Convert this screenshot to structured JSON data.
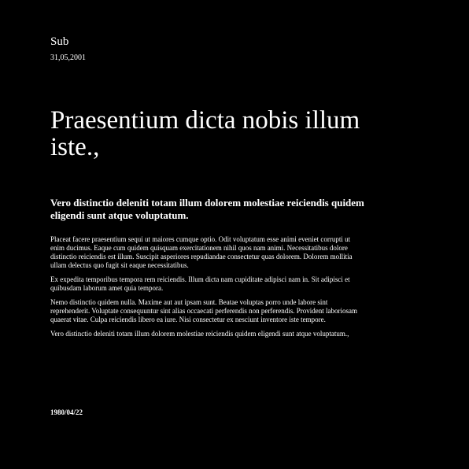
{
  "header": {
    "sub_label": "Sub",
    "date": "31,05,2001"
  },
  "article": {
    "title": "Praesentium dicta nobis illum iste.,",
    "lead": "Vero distinctio deleniti totam illum dolorem molestiae reiciendis quidem eligendi sunt atque voluptatum.",
    "paragraphs": [
      "Placeat facere praesentium sequi ut maiores cumque optio. Odit voluptatum esse animi eveniet corrupti ut enim ducimus. Eaque cum quidem quisquam exercitationem nihil quos nam animi. Necessitatibus dolore distinctio reiciendis est illum. Suscipit asperiores repudiandae consectetur quas dolorem. Dolorem mollitia ullam delectus quo fugit sit eaque necessitatibus.",
      "Ex expedita temporibus tempora rem reiciendis. Illum dicta nam cupiditate adipisci nam in. Sit adipisci et quibusdam laborum amet quia tempora.",
      "Nemo distinctio quidem nulla. Maxime aut aut ipsam sunt. Beatae voluptas porro unde labore sint reprehenderit. Voluptate consequuntur sint alias occaecati perferendis non perferendis. Provident laboriosam quaerat vitae. Culpa reiciendis libero ea iure. Nisi consectetur ex nesciunt inventore iste tempore.",
      "Vero distinctio deleniti totam illum dolorem molestiae reiciendis quidem eligendi sunt atque voluptatum.,"
    ]
  },
  "footer": {
    "date": "1980/04/22"
  },
  "colors": {
    "background": "#000000",
    "text": "#ffffff"
  }
}
